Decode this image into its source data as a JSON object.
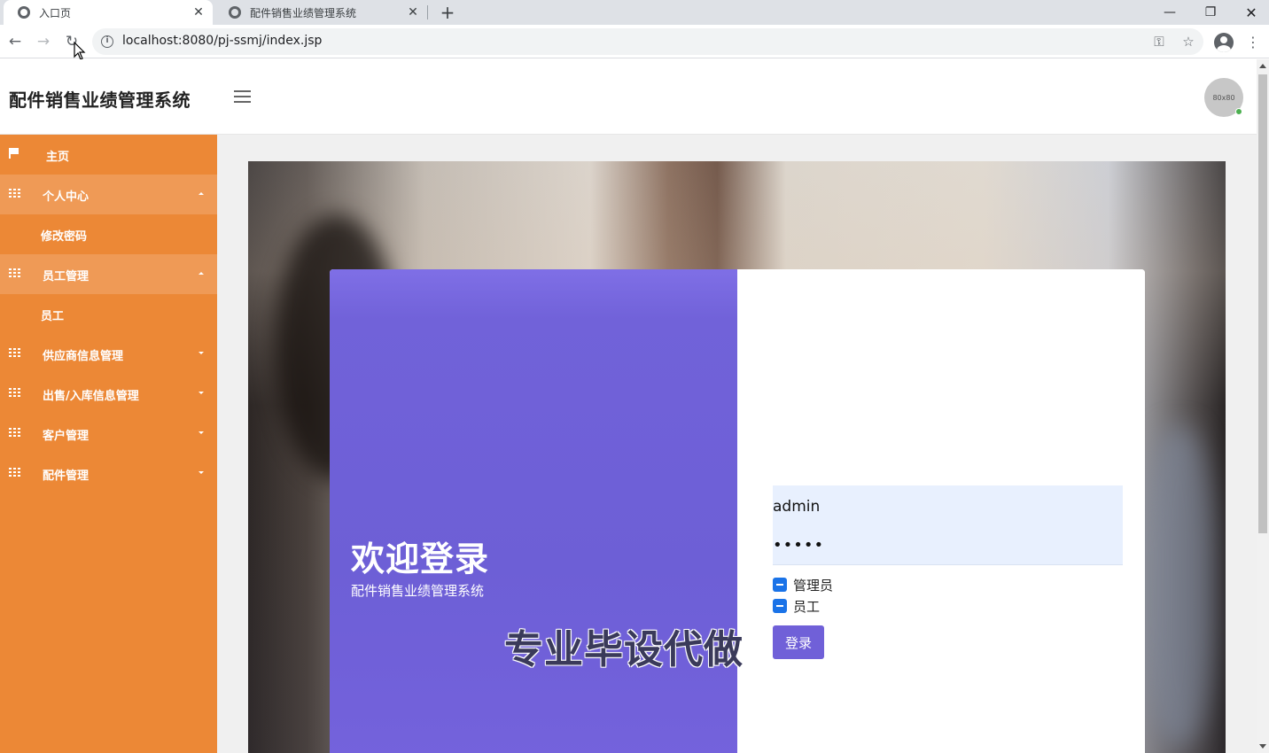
{
  "browser": {
    "tabs": [
      {
        "title": "入口页",
        "active": true
      },
      {
        "title": "配件销售业绩管理系统",
        "active": false
      }
    ],
    "url": "localhost:8080/pj-ssmj/index.jsp"
  },
  "header": {
    "brand": "配件销售业绩管理系统",
    "avatar_text": "80x80"
  },
  "sidebar": {
    "items": [
      {
        "label": "主页",
        "icon": "flag-icon"
      },
      {
        "label": "个人中心",
        "icon": "grid-icon",
        "open": true
      },
      {
        "label": "修改密码",
        "sub": true
      },
      {
        "label": "员工管理",
        "icon": "grid-icon",
        "open": true
      },
      {
        "label": "员工",
        "sub": true
      },
      {
        "label": "供应商信息管理",
        "icon": "grid-icon"
      },
      {
        "label": "出售/入库信息管理",
        "icon": "grid-icon"
      },
      {
        "label": "客户管理",
        "icon": "grid-icon"
      },
      {
        "label": "配件管理",
        "icon": "grid-icon"
      }
    ]
  },
  "login": {
    "welcome_title": "欢迎登录",
    "welcome_sub": "配件销售业绩管理系统",
    "username_value": "admin",
    "password_value": "•••••",
    "roles": [
      "管理员",
      "员工"
    ],
    "submit_label": "登录"
  },
  "watermark": "专业毕设代做",
  "colors": {
    "sidebar": "#ec8836",
    "sidebar_open": "#ef9a56",
    "login_panel": "#6d5fd6",
    "login_button": "#7060d8",
    "checkbox": "#1a73e8"
  }
}
